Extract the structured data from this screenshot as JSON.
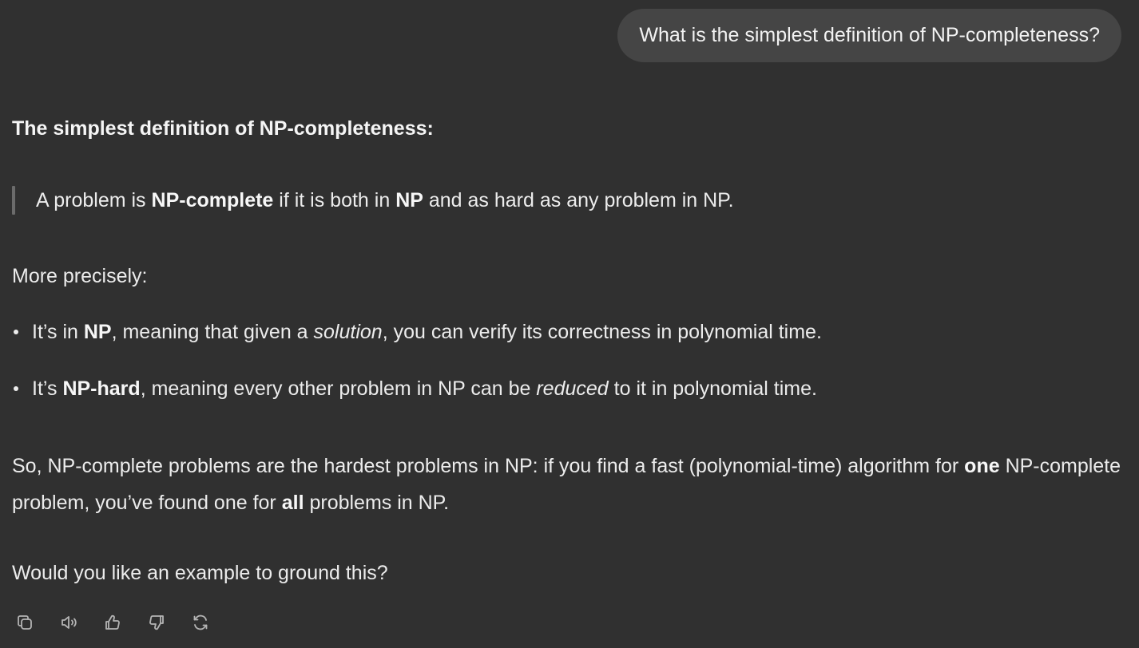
{
  "user_message": {
    "text": "What is the simplest definition of NP-completeness?"
  },
  "answer": {
    "heading": "The simplest definition of NP-completeness:",
    "quote": {
      "t1": "A problem is ",
      "b1": "NP-complete",
      "t2": " if it is both in ",
      "b2": "NP",
      "t3": " and as hard as any problem in NP."
    },
    "intro": "More precisely:",
    "bullets": [
      {
        "t1": "It’s in ",
        "b1": "NP",
        "t2": ", meaning that given a ",
        "i1": "solution",
        "t3": ", you can verify its correctness in polynomial time."
      },
      {
        "t1": "It’s ",
        "b1": "NP-hard",
        "t2": ", meaning every other problem in NP can be ",
        "i1": "reduced",
        "t3": " to it in polynomial time."
      }
    ],
    "summary": {
      "t1": "So, NP-complete problems are the hardest problems in NP: if you find a fast (polynomial-time) algorithm for ",
      "b1": "one",
      "t2": " NP-complete problem, you’ve found one for ",
      "b2": "all",
      "t3": " problems in NP."
    },
    "closing": "Would you like an example to ground this?"
  },
  "actions": [
    {
      "icon": "copy-icon"
    },
    {
      "icon": "speaker-icon"
    },
    {
      "icon": "thumbs-up-icon"
    },
    {
      "icon": "thumbs-down-icon"
    },
    {
      "icon": "regenerate-icon"
    }
  ],
  "colors": {
    "background": "#303030",
    "user_bubble": "#454545",
    "text": "#ececec",
    "icon": "#b4b4b4"
  }
}
